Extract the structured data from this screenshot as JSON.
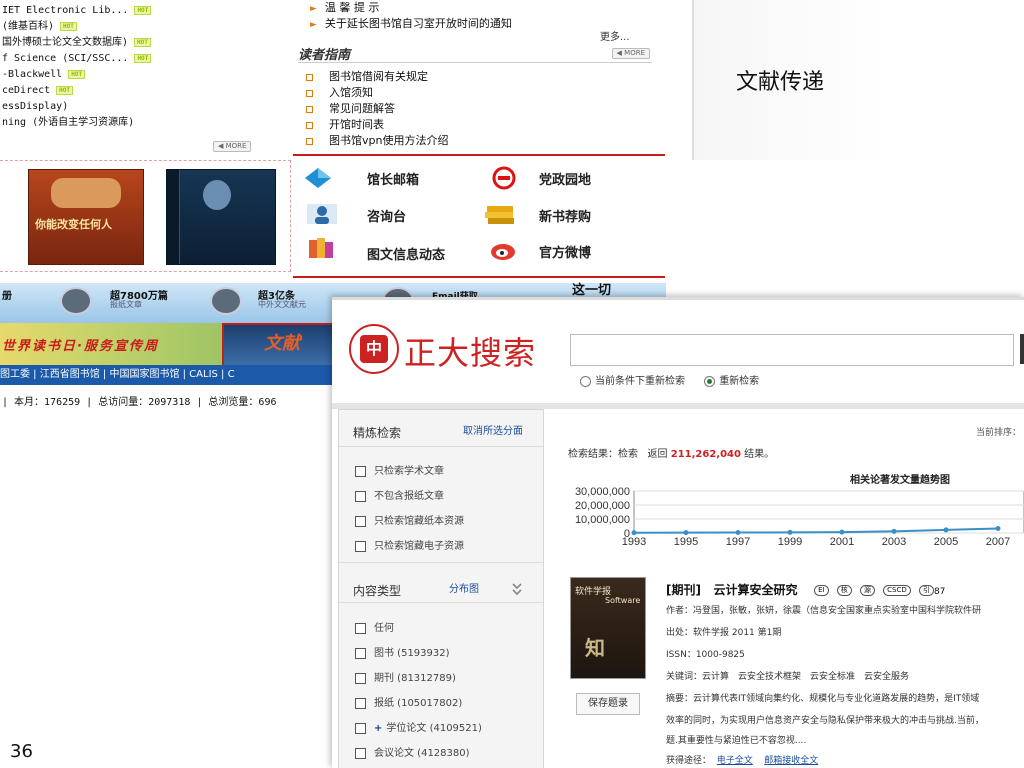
{
  "slide": {
    "title": "文献传递",
    "page_number": "36"
  },
  "library": {
    "databases": [
      "IET Electronic Lib...",
      "(维基百科)",
      "国外博硕士论文全文数据库)",
      "f Science (SCI/SSC...",
      "-Blackwell",
      "ceDirect",
      "essDisplay)",
      "ning (外语自主学习资源库)"
    ],
    "hot_label": "HOT",
    "more_label": "MORE",
    "news": [
      "温 馨 提 示",
      "关于延长图书馆自习室开放时间的通知"
    ],
    "news_more": "更多...",
    "guide_title": "读者指南",
    "guide_items": [
      "图书馆借阅有关规定",
      "入馆须知",
      "常见问题解答",
      "开馆时间表",
      "图书馆vpn使用方法介绍"
    ],
    "book1_title": "你能改变任何人",
    "services": [
      "馆长邮箱",
      "党政园地",
      "咨询台",
      "新书荐购",
      "图文信息动态",
      "官方微博"
    ],
    "banner_items": [
      "册",
      "超7800万篇",
      "报纸文章",
      "超3亿条",
      "中外文文献元",
      "Email获取",
      "这一切"
    ],
    "big_banner_text": "世界读书日·服务宣传周",
    "big_banner_box": "文献",
    "links": "图工委 | 江西省图书馆 | 中国国家图书馆 | CALIS | C",
    "stats": "| 本月：176259 | 总访问量：2097318 | 总浏览量：696"
  },
  "search": {
    "logo_text": "正大搜索",
    "logo_seal": "中",
    "input_value": "",
    "radio_options": [
      {
        "label": "当前条件下重新检索",
        "selected": false
      },
      {
        "label": "重新检索",
        "selected": true
      }
    ],
    "sidebar": {
      "refine_title": "精炼检索",
      "cancel_link": "取消所选分面",
      "refine_options": [
        "只检索学术文章",
        "不包含报纸文章",
        "只检索馆藏纸本资源",
        "只检索馆藏电子资源"
      ],
      "content_type_title": "内容类型",
      "distribution_link": "分布图",
      "content_types": [
        "任何",
        "图书 (5193932)",
        "期刊 (81312789)",
        "报纸 (105017802)",
        "学位论文 (4109521)",
        "会议论文 (4128380)"
      ]
    },
    "sort_label": "当前排序：",
    "result_prefix": "检索结果：检索",
    "result_mid": "返回",
    "result_count": "211,262,040",
    "result_suffix": "结果。",
    "trend_title": "相关论著发文量趋势图",
    "paper": {
      "type": "[期刊]",
      "title": "云计算安全研究",
      "badges": [
        "EI",
        "核",
        "源",
        "CSCD",
        "引"
      ],
      "cited": "87",
      "authors": "作者：冯登国，张敏，张妍，徐震（信息安全国家重点实验室中国科学院软件研",
      "source": "出处：软件学报 2011 第1期",
      "issn": "ISSN：1000-9825",
      "keywords": "关键词：云计算　云安全技术框架　云安全标准　云安全服务",
      "abstract1": "摘要：云计算代表IT领域向集约化、规模化与专业化道路发展的趋势，是IT领域",
      "abstract2": "效率的同时，为实现用户信息资产安全与隐私保护带来极大的冲击与挑战.当前，",
      "abstract3": "题.其重要性与紧迫性已不容忽视....",
      "access_label": "获得途径：",
      "fulltext_link": "电子全文",
      "email_link": "邮箱接收全文",
      "save_button": "保存题录",
      "cover_title": "软件学报",
      "cover_sub": "Software"
    }
  },
  "chart_data": {
    "type": "line",
    "title": "相关论著发文量趋势图",
    "x": [
      1993,
      1995,
      1997,
      1999,
      2001,
      2003,
      2005,
      2007
    ],
    "y": [
      200000,
      300000,
      350000,
      450000,
      650000,
      1200000,
      2200000,
      3200000
    ],
    "x_ticks": [
      "1993",
      "1995",
      "1997",
      "1999",
      "2001",
      "2003",
      "2005",
      "2007"
    ],
    "y_ticks": [
      "30,000,000",
      "20,000,000",
      "10,000,000",
      "0"
    ],
    "ylim": [
      0,
      30000000
    ],
    "color": "#3a8fc7"
  }
}
